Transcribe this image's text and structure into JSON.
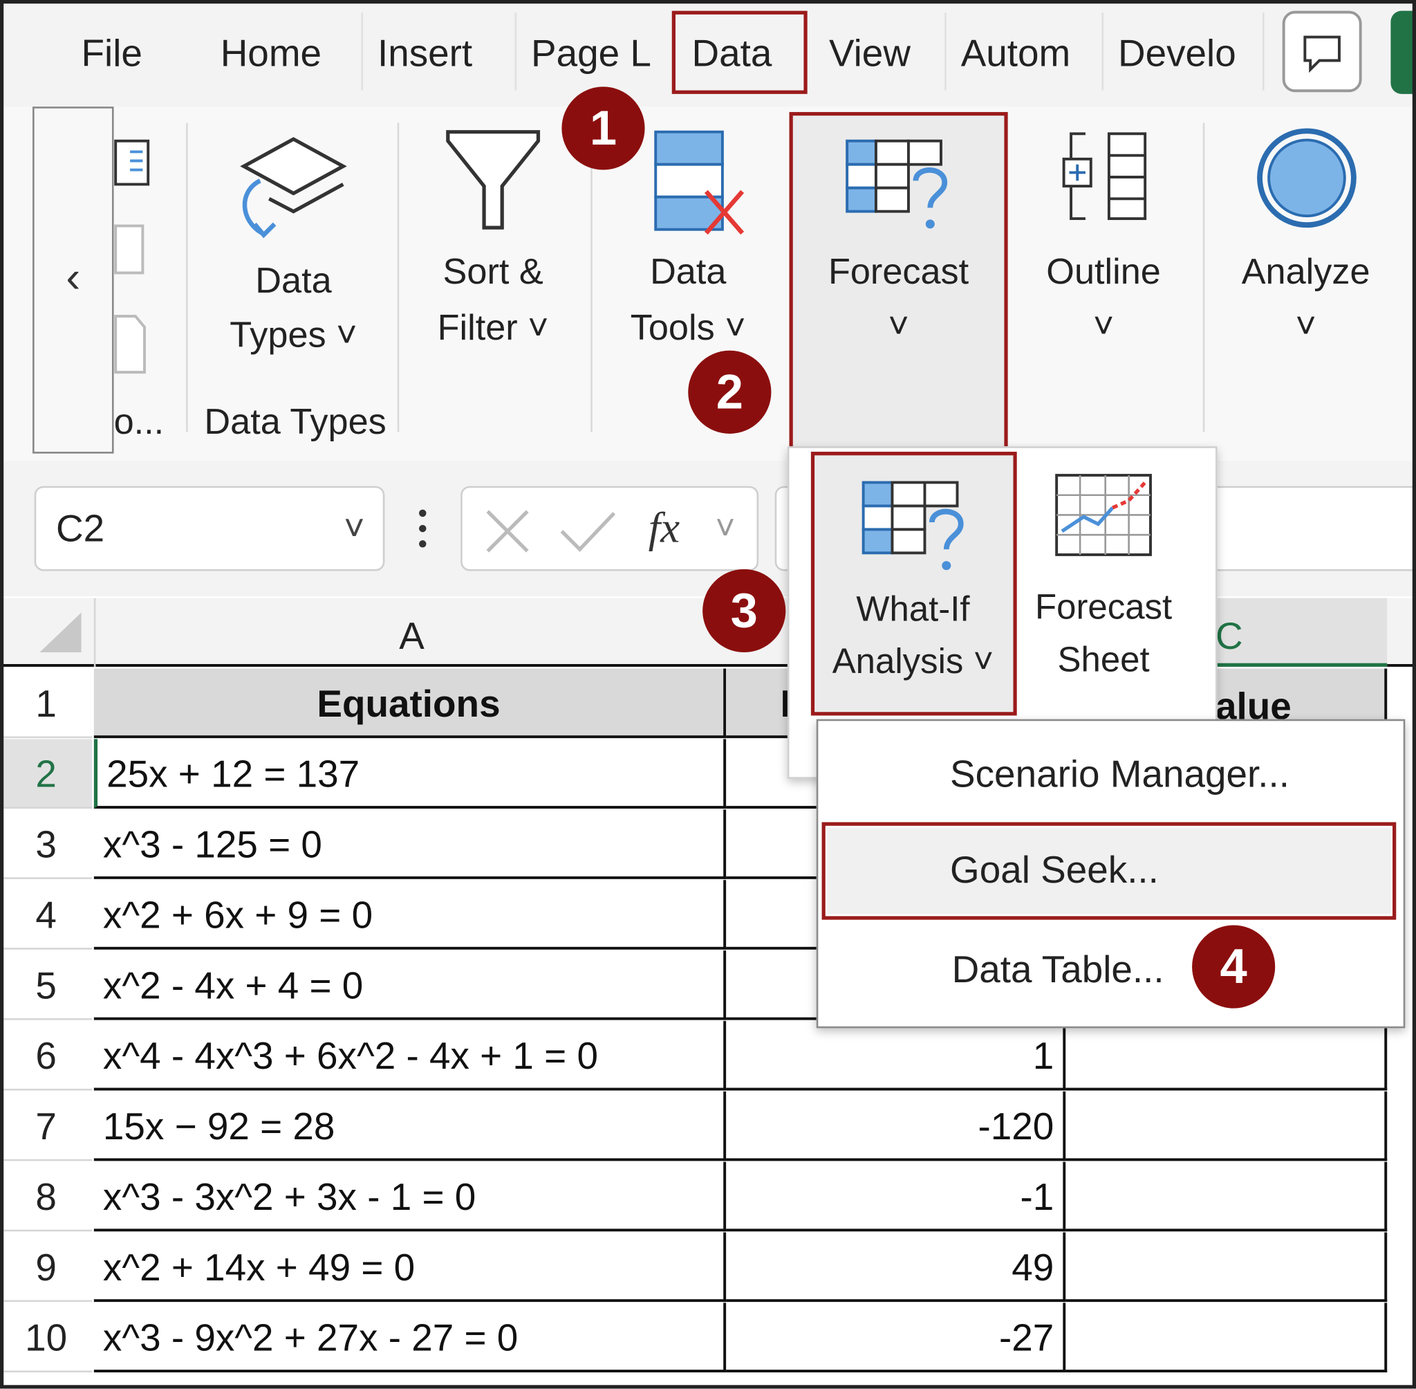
{
  "tabs": [
    {
      "label": "File"
    },
    {
      "label": "Home"
    },
    {
      "label": "Insert"
    },
    {
      "label": "Page L"
    },
    {
      "label": "Data"
    },
    {
      "label": "View"
    },
    {
      "label": "Autom"
    },
    {
      "label": "Develo"
    }
  ],
  "ribbon": {
    "scroll_left_glyph": "‹",
    "partial_group_label": "o...",
    "data_types": {
      "line1": "Data",
      "line2": "Types ˅",
      "group_label": "Data Types"
    },
    "sort_filter": {
      "line1": "Sort &",
      "line2": "Filter ˅"
    },
    "data_tools": {
      "line1": "Data",
      "line2": "Tools ˅"
    },
    "forecast": {
      "line1": "Forecast",
      "line2": "˅"
    },
    "outline": {
      "line1": "Outline",
      "line2": "˅"
    },
    "analyze": {
      "line1": "Analyze",
      "line2": "˅"
    }
  },
  "forecast_dropdown": {
    "what_if": {
      "line1": "What-If",
      "line2": "Analysis ˅"
    },
    "forecast_sheet": {
      "line1": "Forecast",
      "line2": "Sheet"
    }
  },
  "what_if_menu": {
    "scenario_manager": "Scenario Manager...",
    "goal_seek": "Goal Seek...",
    "data_table": "Data Table..."
  },
  "formula_bar": {
    "name_box": "C2",
    "fx": "fx",
    "name_chevron": "˅"
  },
  "grid": {
    "col_a": "A",
    "col_c_partial": "C",
    "header_equations": "Equations",
    "header_b_partial": "I",
    "header_c_partial": "alue",
    "rows": [
      {
        "num": "1"
      },
      {
        "num": "2",
        "eq": "25x + 12 = 137",
        "b": ""
      },
      {
        "num": "3",
        "eq": "x^3 - 125 = 0",
        "b": ""
      },
      {
        "num": "4",
        "eq": "x^2 + 6x + 9 = 0",
        "b": ""
      },
      {
        "num": "5",
        "eq": "x^2 - 4x + 4 = 0",
        "b": ""
      },
      {
        "num": "6",
        "eq": "x^4 - 4x^3 + 6x^2 - 4x + 1 = 0",
        "b": "1"
      },
      {
        "num": "7",
        "eq": "15x − 92 = 28",
        "b": "-120"
      },
      {
        "num": "8",
        "eq": "x^3 - 3x^2 + 3x - 1 = 0",
        "b": "-1"
      },
      {
        "num": "9",
        "eq": "x^2 + 14x + 49 = 0",
        "b": "49"
      },
      {
        "num": "10",
        "eq": "x^3 - 9x^2 + 27x - 27 = 0",
        "b": "-27"
      }
    ]
  },
  "steps": [
    "1",
    "2",
    "3",
    "4"
  ],
  "colors": {
    "accent_red": "#9b1b1b",
    "badge": "#8b0e0e",
    "excel_green": "#217346",
    "icon_blue": "#4a90d9"
  }
}
